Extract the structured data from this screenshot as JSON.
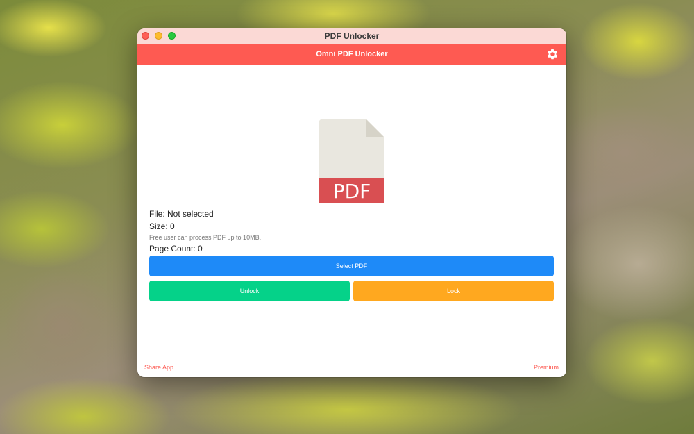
{
  "window": {
    "title": "PDF Unlocker"
  },
  "appbar": {
    "title": "Omni PDF Unlocker",
    "settings_icon": "gear-icon"
  },
  "file_icon": {
    "label": "PDF",
    "icon": "pdf-file-icon"
  },
  "file_info": {
    "file": "File: Not selected",
    "size": "Size: 0",
    "note": "Free user can process PDF up to 10MB.",
    "page_count": "Page Count: 0"
  },
  "buttons": {
    "select": "Select PDF",
    "unlock": "Unlock",
    "lock": "Lock"
  },
  "footer": {
    "share": "Share App",
    "premium": "Premium"
  },
  "colors": {
    "titlebar": "#fbd9d5",
    "appbar": "#fe5a52",
    "select": "#1e8af8",
    "unlock": "#05d289",
    "lock": "#ffa81f",
    "pdf_band": "#d94f52",
    "pdf_page": "#e9e7df"
  }
}
